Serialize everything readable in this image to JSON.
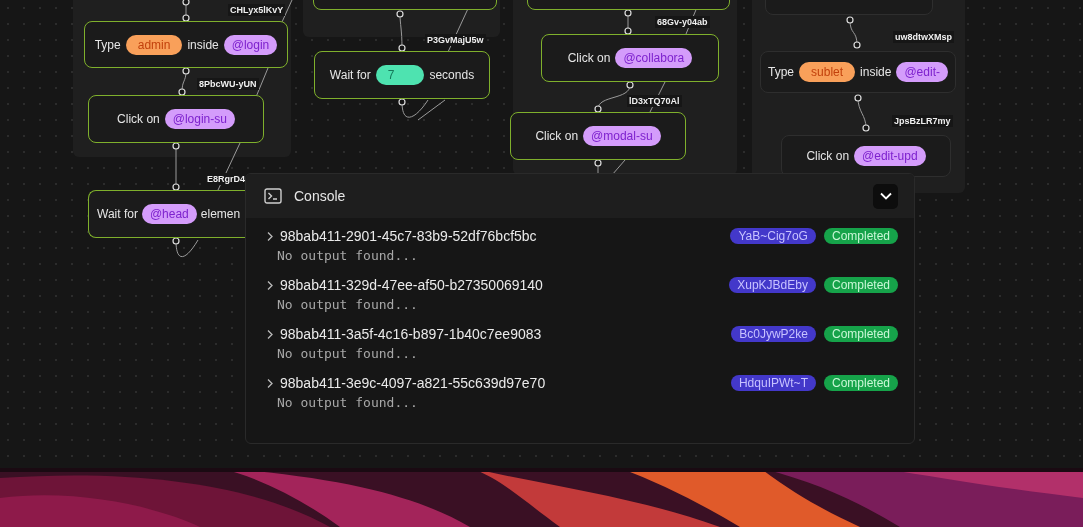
{
  "canvas": {
    "nodes": [
      {
        "active": true
      },
      {
        "active": true
      },
      {
        "active": false
      },
      {
        "active": true,
        "parts": [
          {
            "kind": "text",
            "text": "Type"
          },
          {
            "kind": "string",
            "text": "admin"
          },
          {
            "kind": "text",
            "text": "inside"
          },
          {
            "kind": "selector",
            "text": "@login"
          }
        ]
      },
      {
        "active": true,
        "parts": [
          {
            "kind": "text",
            "text": "Click on"
          },
          {
            "kind": "selector",
            "text": "@login-su"
          }
        ]
      },
      {
        "active": true,
        "parts": [
          {
            "kind": "text",
            "text": "Wait for"
          },
          {
            "kind": "selector",
            "text": "@head"
          },
          {
            "kind": "text",
            "text": "elemen"
          }
        ]
      },
      {
        "active": true,
        "parts": [
          {
            "kind": "text",
            "text": "Wait for"
          },
          {
            "kind": "number",
            "text": "7"
          },
          {
            "kind": "text",
            "text": "seconds"
          }
        ]
      },
      {
        "active": true,
        "parts": [
          {
            "kind": "text",
            "text": "Click on"
          },
          {
            "kind": "selector",
            "text": "@collabora"
          }
        ]
      },
      {
        "active": true,
        "parts": [
          {
            "kind": "text",
            "text": "Click on"
          },
          {
            "kind": "selector",
            "text": "@modal-su"
          }
        ]
      },
      {
        "active": false,
        "parts": [
          {
            "kind": "text",
            "text": "Type"
          },
          {
            "kind": "string",
            "text": "sublet"
          },
          {
            "kind": "text",
            "text": "inside"
          },
          {
            "kind": "selector",
            "text": "@edit-"
          }
        ]
      },
      {
        "active": false,
        "parts": [
          {
            "kind": "text",
            "text": "Click on"
          },
          {
            "kind": "selector",
            "text": "@edit-upd"
          }
        ]
      }
    ],
    "edge_labels": [
      "CHLyx5lKvY",
      "8PbcWU-yUN",
      "E8RgrD4",
      "P3GvMajU5w",
      "68Gv-y04ab",
      "lD3xTQ70Al",
      "uw8dtwXMsp",
      "JpsBzLR7my"
    ]
  },
  "console": {
    "title": "Console",
    "runs": [
      {
        "id": "98bab411-2901-45c7-83b9-52df76bcf5bc",
        "tag": "YaB~Cig7oG",
        "status": "Completed",
        "output": "No output found..."
      },
      {
        "id": "98bab411-329d-47ee-af50-b27350069140",
        "tag": "XupKJBdEby",
        "status": "Completed",
        "output": "No output found..."
      },
      {
        "id": "98bab411-3a5f-4c16-b897-1b40c7ee9083",
        "tag": "Bc0JywP2ke",
        "status": "Completed",
        "output": "No output found..."
      },
      {
        "id": "98bab411-3e9c-4097-a821-55c639d97e70",
        "tag": "HdquIPWt~T",
        "status": "Completed",
        "output": "No output found..."
      }
    ]
  }
}
